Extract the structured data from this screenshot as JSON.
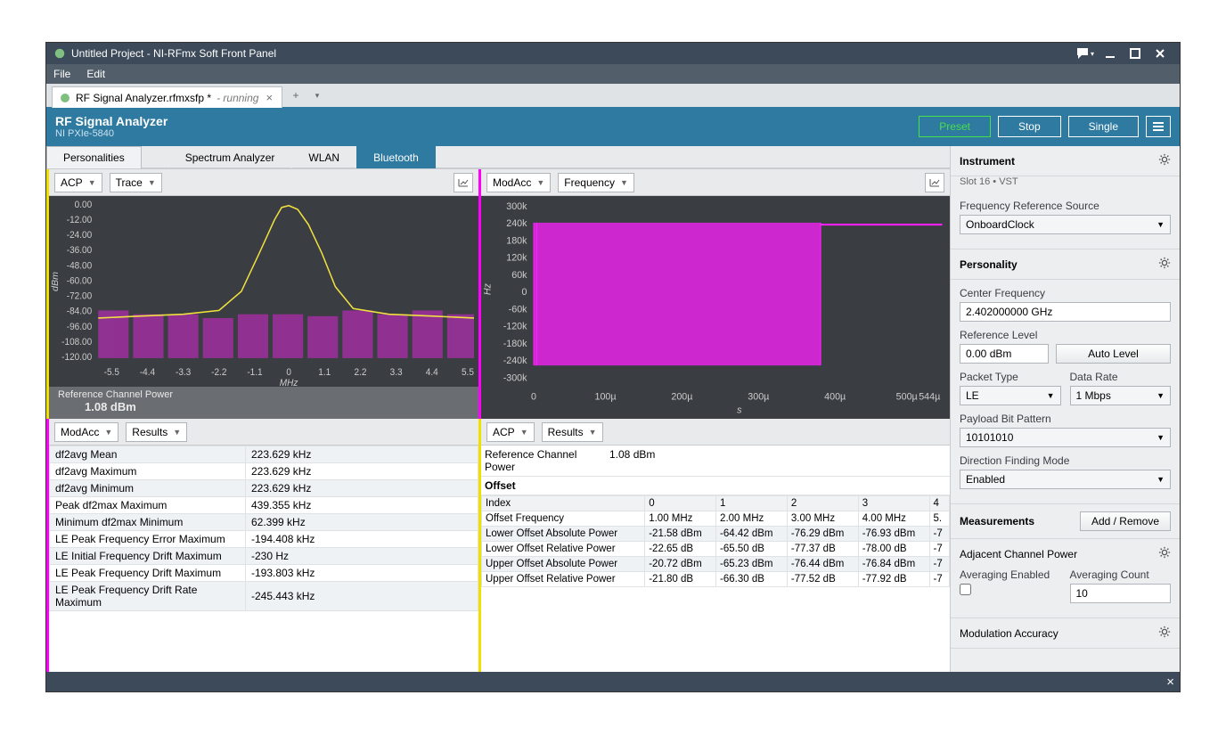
{
  "titlebar": {
    "text": "Untitled Project - NI-RFmx Soft Front Panel"
  },
  "menubar": {
    "file": "File",
    "edit": "Edit"
  },
  "doc_tab": {
    "name": "RF Signal Analyzer.rfmxsfp *",
    "status": "- running"
  },
  "header": {
    "title": "RF Signal Analyzer",
    "sub": "NI PXIe-5840",
    "preset": "Preset",
    "stop": "Stop",
    "single": "Single"
  },
  "ptabs": {
    "personalities": "Personalities",
    "sa": "Spectrum Analyzer",
    "wlan": "WLAN",
    "bt": "Bluetooth"
  },
  "panel_tl": {
    "dd1": "ACP",
    "dd2": "Trace",
    "footer_label": "Reference Channel Power",
    "footer_val": "1.08 dBm"
  },
  "panel_tr": {
    "dd1": "ModAcc",
    "dd2": "Frequency"
  },
  "panel_bl": {
    "dd1": "ModAcc",
    "dd2": "Results",
    "rows": [
      {
        "k": "df2avg Mean",
        "v": "223.629 kHz"
      },
      {
        "k": "df2avg Maximum",
        "v": "223.629 kHz"
      },
      {
        "k": "df2avg Minimum",
        "v": "223.629 kHz"
      },
      {
        "k": "Peak df2max Maximum",
        "v": "439.355 kHz"
      },
      {
        "k": "Minimum df2max Minimum",
        "v": "62.399 kHz"
      },
      {
        "k": "LE Peak Frequency Error Maximum",
        "v": "-194.408 kHz"
      },
      {
        "k": "LE Initial Frequency Drift Maximum",
        "v": "-230 Hz"
      },
      {
        "k": "LE Peak Frequency Drift Maximum",
        "v": "-193.803 kHz"
      },
      {
        "k": "LE Peak Frequency Drift Rate Maximum",
        "v": "-245.443 kHz"
      }
    ]
  },
  "panel_br": {
    "dd1": "ACP",
    "dd2": "Results",
    "rcp_label": "Reference Channel Power",
    "rcp_val": "1.08 dBm",
    "offset_label": "Offset",
    "headers": [
      "Index",
      "0",
      "1",
      "2",
      "3",
      "4"
    ],
    "rows": [
      {
        "k": "Offset Frequency",
        "v": [
          "1.00 MHz",
          "2.00 MHz",
          "3.00 MHz",
          "4.00 MHz",
          "5."
        ]
      },
      {
        "k": "Lower Offset Absolute Power",
        "v": [
          "-21.58 dBm",
          "-64.42 dBm",
          "-76.29 dBm",
          "-76.93 dBm",
          "-7"
        ]
      },
      {
        "k": "Lower Offset Relative Power",
        "v": [
          "-22.65 dB",
          "-65.50 dB",
          "-77.37 dB",
          "-78.00 dB",
          "-7"
        ]
      },
      {
        "k": "Upper Offset Absolute Power",
        "v": [
          "-20.72 dBm",
          "-65.23 dBm",
          "-76.44 dBm",
          "-76.84 dBm",
          "-7"
        ]
      },
      {
        "k": "Upper Offset Relative Power",
        "v": [
          "-21.80 dB",
          "-66.30 dB",
          "-77.52 dB",
          "-77.92 dB",
          "-7"
        ]
      }
    ]
  },
  "sidebar": {
    "instrument": {
      "title": "Instrument",
      "slot": "Slot 16  •  VST",
      "frs_label": "Frequency Reference Source",
      "frs_val": "OnboardClock"
    },
    "personality": {
      "title": "Personality",
      "cf_label": "Center Frequency",
      "cf_val": "2.402000000 GHz",
      "rl_label": "Reference Level",
      "rl_val": "0.00 dBm",
      "auto": "Auto Level",
      "pt_label": "Packet Type",
      "pt_val": "LE",
      "dr_label": "Data Rate",
      "dr_val": "1 Mbps",
      "pbp_label": "Payload Bit Pattern",
      "pbp_val": "10101010",
      "dfm_label": "Direction Finding Mode",
      "dfm_val": "Enabled"
    },
    "measurements": {
      "title": "Measurements",
      "addremove": "Add / Remove",
      "acp": "Adjacent Channel Power",
      "avgen_label": "Averaging Enabled",
      "avgcnt_label": "Averaging Count",
      "avgcnt_val": "10",
      "modacc": "Modulation Accuracy"
    }
  },
  "chart_data": [
    {
      "type": "bar+line",
      "title": "ACP Trace",
      "xlabel": "MHz",
      "ylabel": "dBm",
      "xlim": [
        -5.5,
        5.5
      ],
      "ylim": [
        -120,
        0
      ],
      "xticks": [
        -5.5,
        -4.4,
        -3.3,
        -2.2,
        -1.1,
        0,
        1.1,
        2.2,
        3.3,
        4.4,
        5.5
      ],
      "yticks": [
        0,
        -12,
        -24,
        -36,
        -48,
        -60,
        -72,
        -84,
        -96,
        -108,
        -120
      ],
      "bars": {
        "x": [
          -5.5,
          -4.4,
          -3.3,
          -2.2,
          -1.1,
          0,
          1.1,
          2.2,
          3.3,
          4.4,
          5.5
        ],
        "y": [
          -80,
          -82,
          -82,
          -84,
          -82,
          -82,
          -83,
          -80,
          -82,
          -80,
          -82
        ]
      },
      "line_profile": "lobed spectrum peaking near 0 dBm at 0 MHz, falling to about -85 dBm noise floor beyond ±2 MHz"
    },
    {
      "type": "line",
      "title": "ModAcc Frequency",
      "xlabel": "s",
      "ylabel": "Hz",
      "xlim": [
        0,
        0.000544
      ],
      "ylim": [
        -300000,
        300000
      ],
      "xticks_label": [
        "0",
        "100µ",
        "200µ",
        "300µ",
        "400µ",
        "500µ",
        "544µ"
      ],
      "yticks_label": [
        "300k",
        "240k",
        "180k",
        "120k",
        "60k",
        "0",
        "-60k",
        "-120k",
        "-180k",
        "-240k",
        "-300k"
      ],
      "profile": "dense binary-like excursions oscillating roughly between -250k and +250k Hz for 0–420µs, then flat at roughly +250k Hz until 544µs"
    }
  ]
}
